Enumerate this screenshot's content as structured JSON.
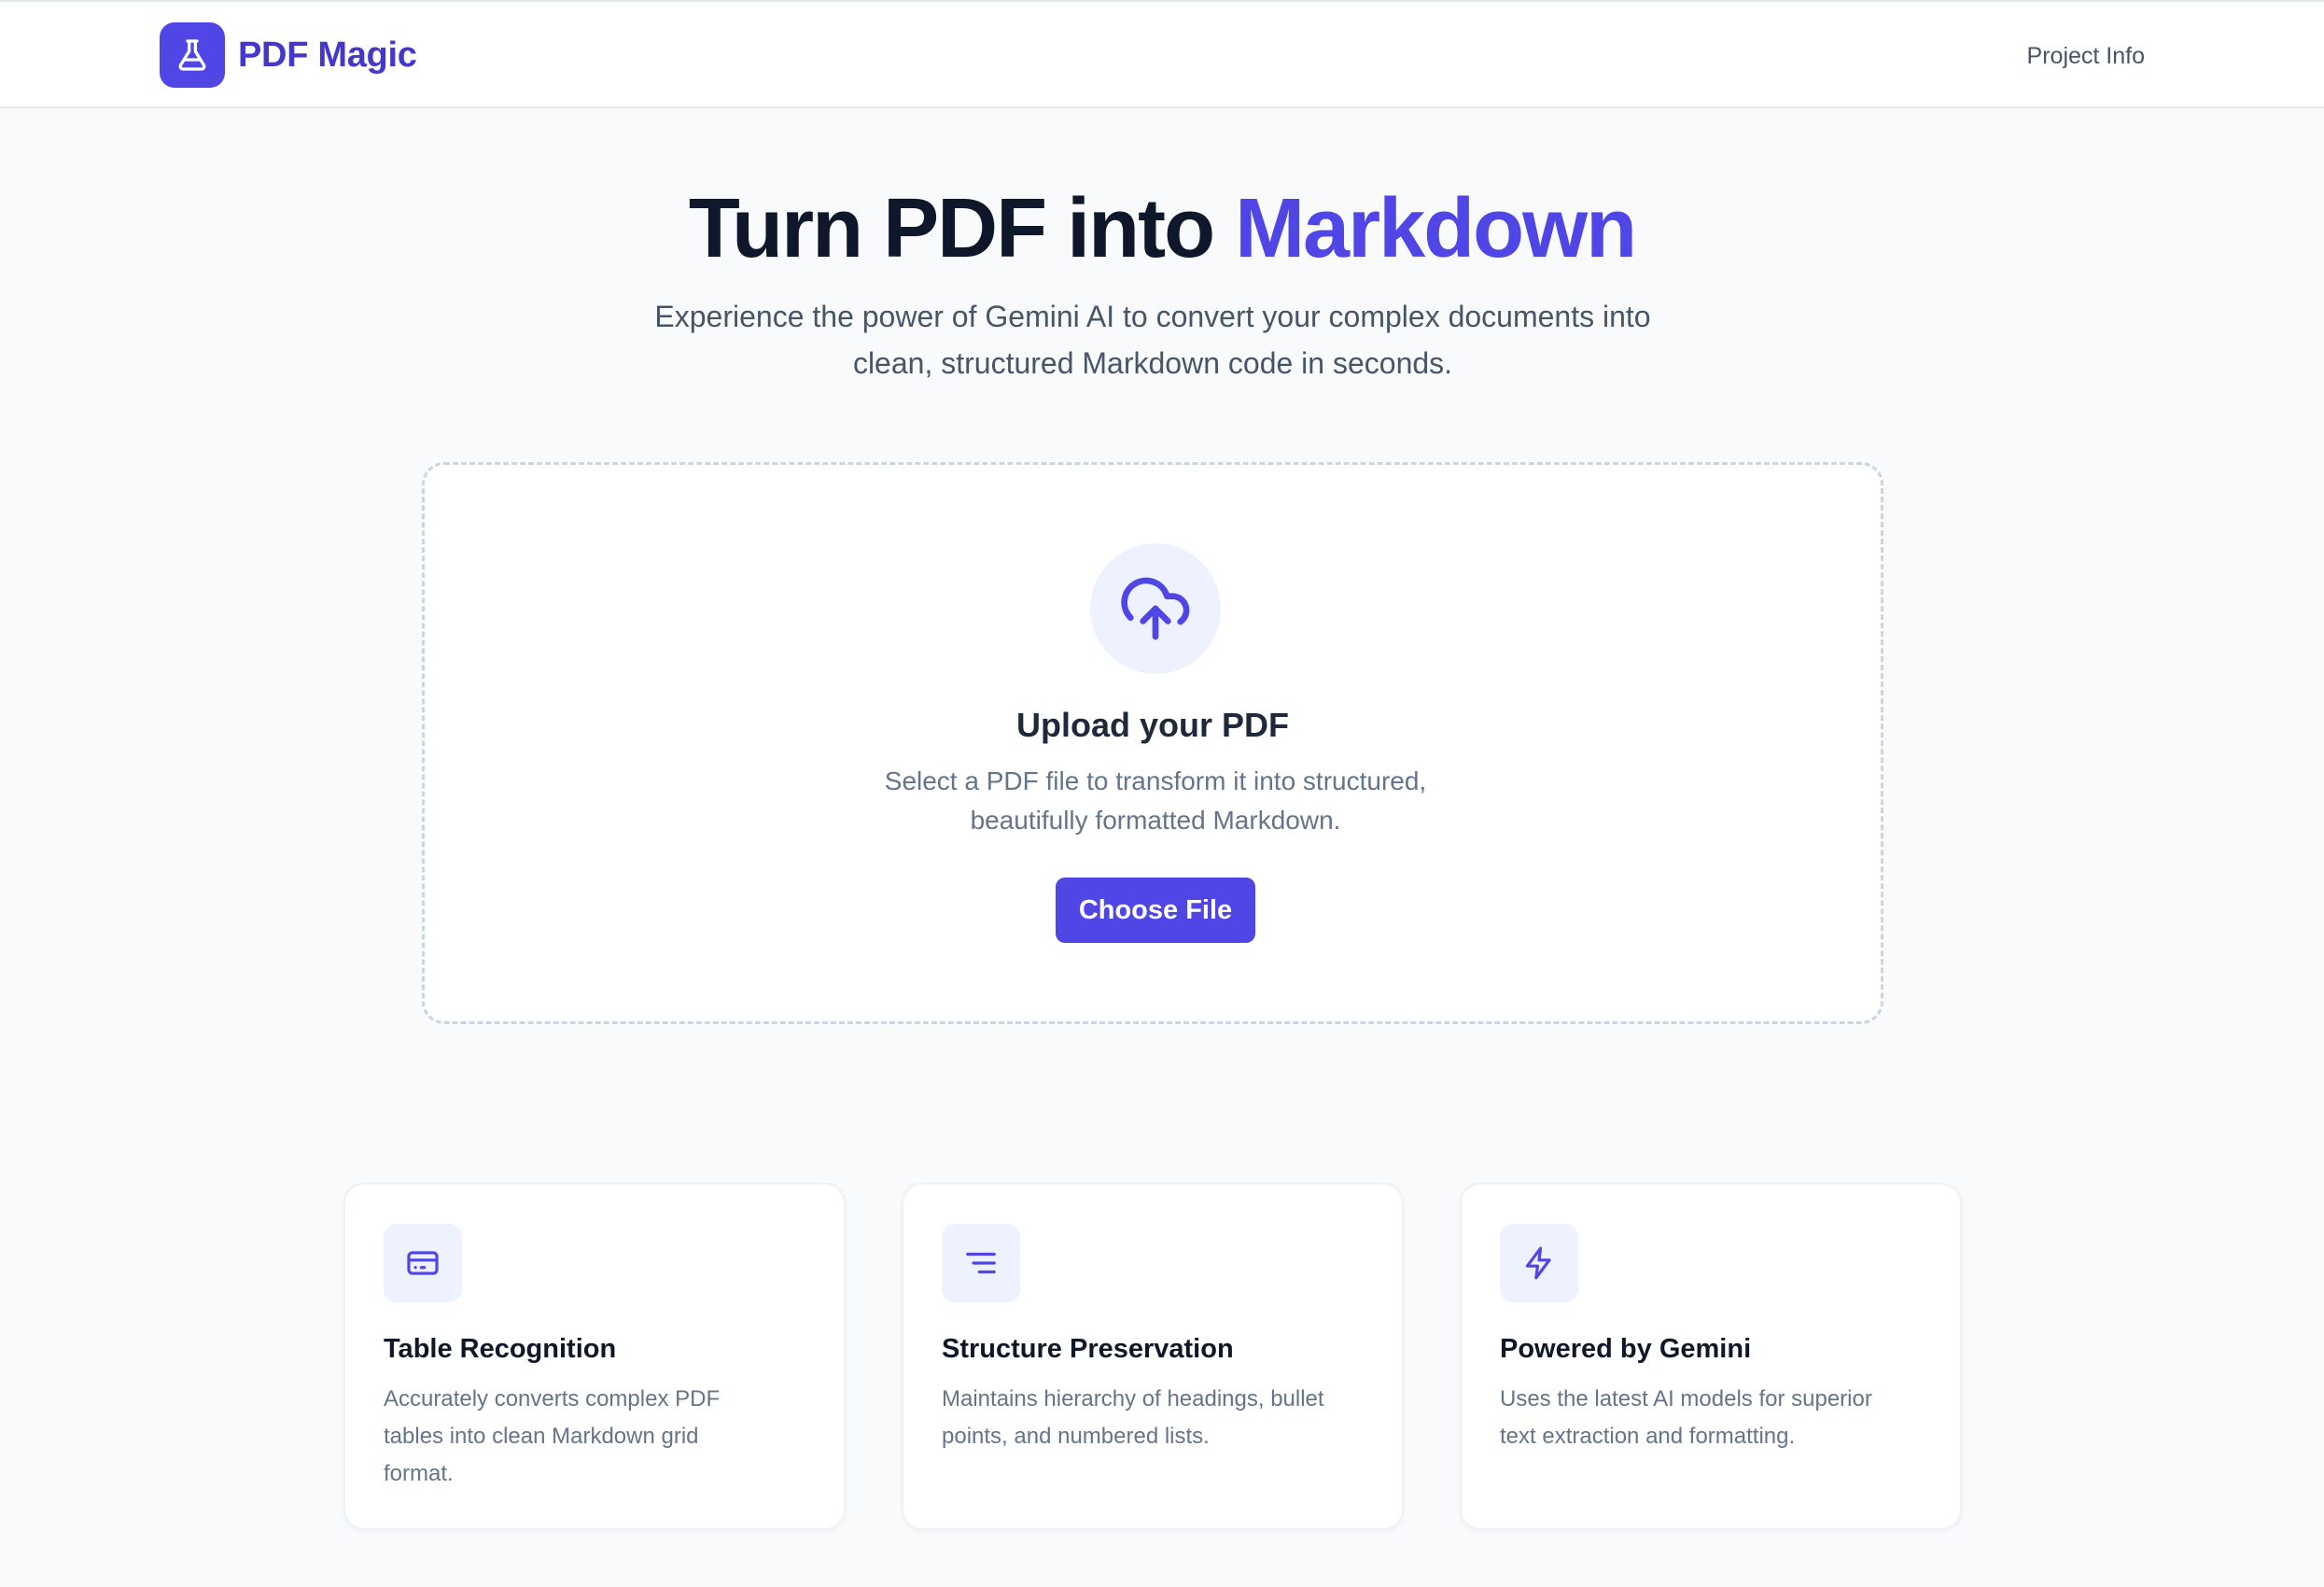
{
  "header": {
    "logo_icon": "flask-icon",
    "logo_text": "PDF Magic",
    "nav_link": "Project Info"
  },
  "hero": {
    "title_main": "Turn PDF into ",
    "title_accent": "Markdown",
    "subtitle_line1": "Experience the power of Gemini AI to convert your complex documents into",
    "subtitle_line2": "clean, structured Markdown code in seconds."
  },
  "upload": {
    "icon": "cloud-upload-icon",
    "title": "Upload your PDF",
    "desc_line1": "Select a PDF file to transform it into structured,",
    "desc_line2": "beautifully formatted Markdown.",
    "button_label": "Choose File"
  },
  "features": [
    {
      "icon": "table-icon",
      "title": "Table Recognition",
      "desc_line1": "Accurately converts complex PDF",
      "desc_line2": "tables into clean Markdown grid",
      "desc_line3": "format."
    },
    {
      "icon": "text-align-icon",
      "title": "Structure Preservation",
      "desc_line1": "Maintains hierarchy of headings, bullet",
      "desc_line2": "points, and numbered lists."
    },
    {
      "icon": "lightning-icon",
      "title": "Powered by Gemini",
      "desc_line1": "Uses the latest AI models for superior",
      "desc_line2": "text extraction and formatting."
    }
  ],
  "colors": {
    "brand": "#4f46e5",
    "brand_dark": "#4338ca",
    "icon_bg": "#eef2ff",
    "page_bg": "#f8fafc"
  }
}
